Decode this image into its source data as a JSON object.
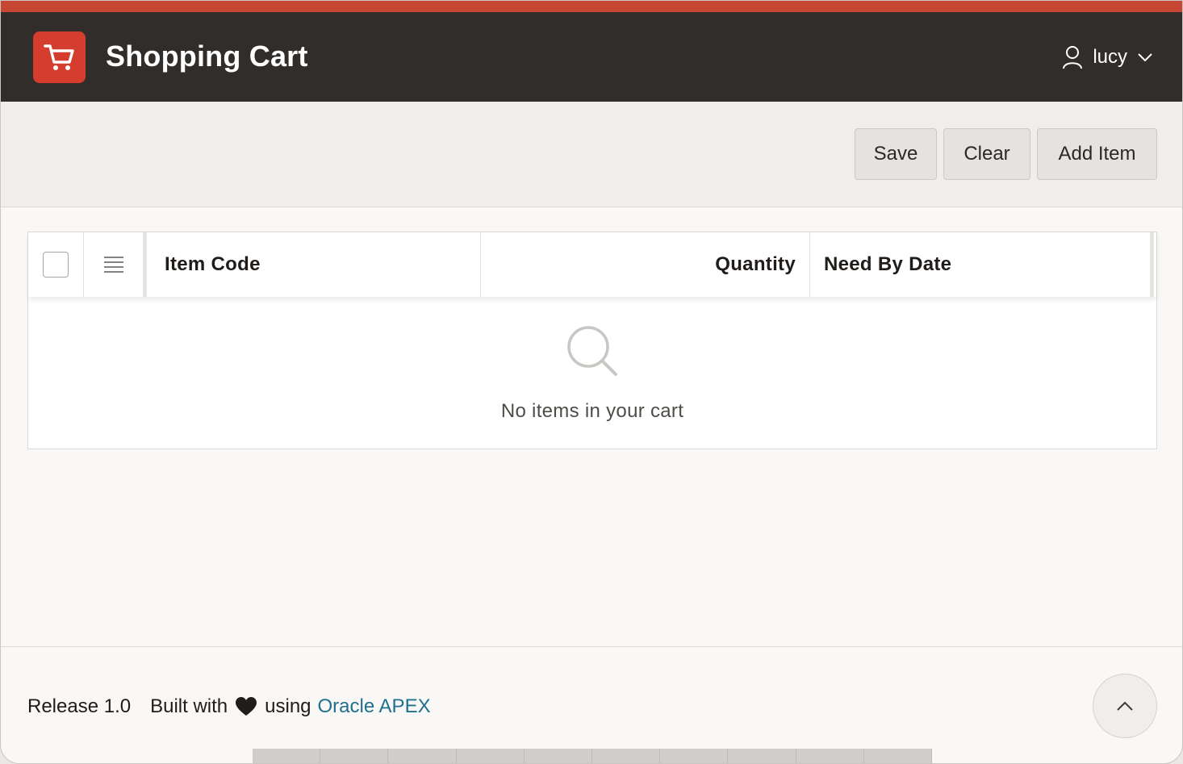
{
  "header": {
    "app_title": "Shopping Cart",
    "logo_icon": "shopping-cart-icon",
    "user_name": "lucy",
    "user_icon": "user-icon",
    "user_menu_icon": "chevron-down-icon"
  },
  "toolbar": {
    "save_label": "Save",
    "clear_label": "Clear",
    "add_item_label": "Add Item"
  },
  "grid": {
    "columns": [
      "Item Code",
      "Quantity",
      "Need By Date"
    ],
    "empty_message": "No items in your cart",
    "empty_icon": "search-icon"
  },
  "footer": {
    "release": "Release 1.0",
    "built_with": "Built with",
    "using": "using",
    "link_text": "Oracle APEX",
    "heart_icon": "heart-icon",
    "to_top_icon": "chevron-up-icon"
  },
  "colors": {
    "accent": "#c74634",
    "header_bg": "#312d2a",
    "logo_bg": "#d53d2f",
    "link": "#20708e"
  }
}
